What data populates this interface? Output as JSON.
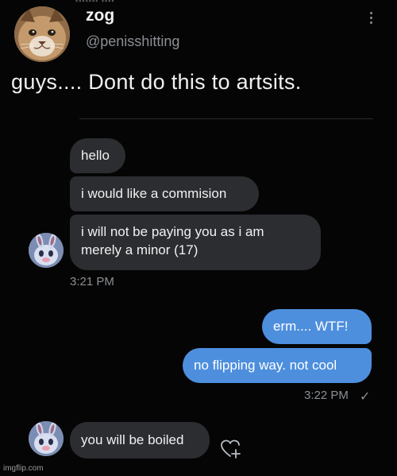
{
  "tweet": {
    "display_name": "zog",
    "handle": "@penisshitting",
    "text": "guys.... Dont do this to artsits."
  },
  "messages": [
    {
      "text": "hello"
    },
    {
      "text": "i would like a commision"
    },
    {
      "line1": "i will not be paying you as i am",
      "line2": "merely a minor (17)"
    },
    {
      "text": "erm.... WTF!"
    },
    {
      "text": "no flipping way. not cool"
    },
    {
      "text": "you will be boiled"
    }
  ],
  "times": {
    "first": "3:21 PM",
    "second": "3:22 PM",
    "check": "✓"
  },
  "watermark": "imgflip.com",
  "icons": {
    "more": "more-vertical-icon",
    "react": "heart-plus-icon",
    "read": "checkmark-icon"
  },
  "colors": {
    "background": "#050505",
    "incoming_bubble": "#2c2d31",
    "outgoing_bubble": "#4d8fdd",
    "muted_text": "#8b8f94"
  }
}
